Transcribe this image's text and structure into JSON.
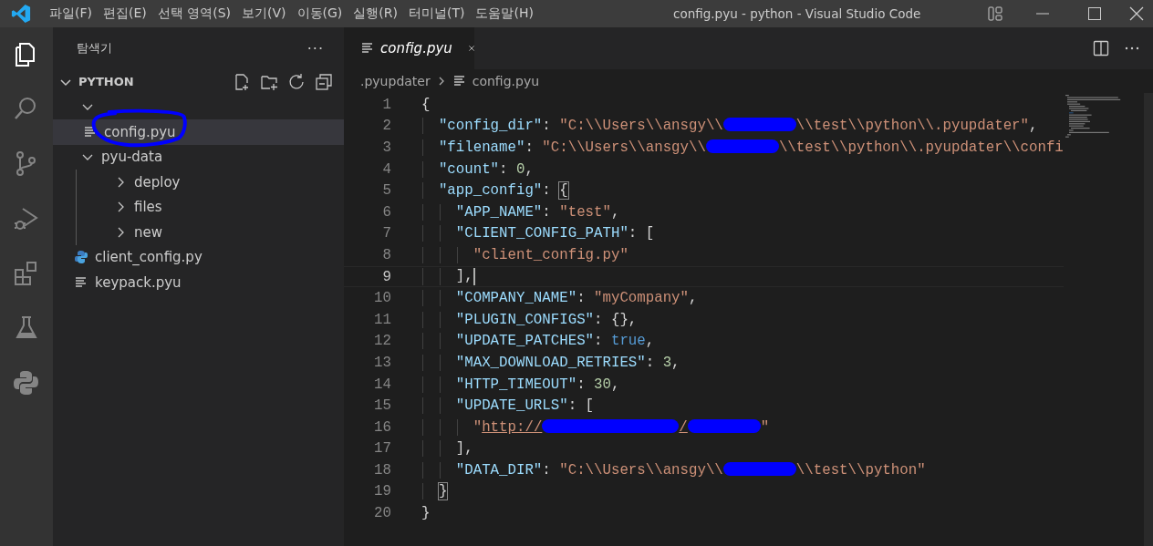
{
  "window": {
    "title": "config.pyu - python - Visual Studio Code"
  },
  "menu": [
    "파일(F)",
    "편집(E)",
    "선택 영역(S)",
    "보기(V)",
    "이동(G)",
    "실행(R)",
    "터미널(T)",
    "도움말(H)"
  ],
  "activity_bar": [
    {
      "kind": "explorer",
      "selected": true
    },
    {
      "kind": "search",
      "selected": false
    },
    {
      "kind": "source-control",
      "selected": false
    },
    {
      "kind": "run-debug",
      "selected": false
    },
    {
      "kind": "extensions",
      "selected": false
    },
    {
      "kind": "testing",
      "selected": false
    },
    {
      "kind": "python",
      "selected": false
    }
  ],
  "sidebar": {
    "title": "탐색기",
    "more": "···",
    "section": {
      "label": "PYTHON",
      "expanded": true,
      "tree": [
        {
          "kind": "folder",
          "expanded": true,
          "selected": false,
          "children": [
            {
              "kind": "file",
              "label": "config.pyu",
              "selected": true
            }
          ]
        },
        {
          "kind": "folder",
          "label": "pyu-data",
          "expanded": true,
          "selected": false,
          "children": [
            {
              "kind": "folder",
              "label": "deploy",
              "expanded": false,
              "selected": false
            },
            {
              "kind": "folder",
              "label": "files",
              "expanded": false,
              "selected": false
            },
            {
              "kind": "folder",
              "label": "new",
              "expanded": false,
              "selected": false
            }
          ]
        },
        {
          "kind": "python",
          "label": "client_config.py",
          "selected": false
        },
        {
          "kind": "file",
          "label": "keypack.pyu",
          "selected": false
        }
      ]
    }
  },
  "tabs": [
    {
      "label": "config.pyu",
      "selected": true,
      "preview": true
    }
  ],
  "breadcrumb": [
    ".pyupdater",
    "config.pyu"
  ],
  "editor": {
    "lines": [
      {
        "number": "1",
        "current": false,
        "tokens": [
          {
            "kind": "punct",
            "text": "{"
          }
        ]
      },
      {
        "number": "2",
        "current": false,
        "tokens": [
          {
            "kind": "key",
            "text": "  \"config_dir\""
          },
          {
            "kind": "punct",
            "text": ": "
          },
          {
            "kind": "str",
            "text": "\"C:\\\\Users\\\\ansgy\\\\"
          },
          {
            "kind": "redacted"
          },
          {
            "kind": "str",
            "text": "\\\\test\\\\python\\\\.pyupdater\""
          },
          {
            "kind": "punct",
            "text": ","
          }
        ]
      },
      {
        "number": "3",
        "current": false,
        "tokens": [
          {
            "kind": "key",
            "text": "  \"filename\""
          },
          {
            "kind": "punct",
            "text": ": "
          },
          {
            "kind": "str",
            "text": "\"C:\\\\Users\\\\ansgy\\\\"
          },
          {
            "kind": "redacted"
          },
          {
            "kind": "str",
            "text": "\\\\test\\\\python\\\\.pyupdater\\\\confi"
          }
        ]
      },
      {
        "number": "4",
        "current": false,
        "tokens": [
          {
            "kind": "key",
            "text": "  \"count\""
          },
          {
            "kind": "punct",
            "text": ": "
          },
          {
            "kind": "num",
            "text": "0"
          },
          {
            "kind": "punct",
            "text": ","
          }
        ]
      },
      {
        "number": "5",
        "current": false,
        "tokens": [
          {
            "kind": "key",
            "text": "  \"app_config\""
          },
          {
            "kind": "punct",
            "text": ": "
          },
          {
            "kind": "bracket-match",
            "text": "{"
          }
        ]
      },
      {
        "number": "6",
        "current": false,
        "tokens": [
          {
            "kind": "key",
            "text": "    \"APP_NAME\""
          },
          {
            "kind": "punct",
            "text": ": "
          },
          {
            "kind": "str",
            "text": "\"test\""
          },
          {
            "kind": "punct",
            "text": ","
          }
        ]
      },
      {
        "number": "7",
        "current": false,
        "tokens": [
          {
            "kind": "key",
            "text": "    \"CLIENT_CONFIG_PATH\""
          },
          {
            "kind": "punct",
            "text": ": ["
          }
        ]
      },
      {
        "number": "8",
        "current": false,
        "tokens": [
          {
            "kind": "str",
            "text": "      \"client_config.py\""
          }
        ]
      },
      {
        "number": "9",
        "current": true,
        "tokens": [
          {
            "kind": "punct",
            "text": "    ],"
          }
        ]
      },
      {
        "number": "10",
        "current": false,
        "tokens": [
          {
            "kind": "key",
            "text": "    \"COMPANY_NAME\""
          },
          {
            "kind": "punct",
            "text": ": "
          },
          {
            "kind": "str",
            "text": "\"myCompany\""
          },
          {
            "kind": "punct",
            "text": ","
          }
        ]
      },
      {
        "number": "11",
        "current": false,
        "tokens": [
          {
            "kind": "key",
            "text": "    \"PLUGIN_CONFIGS\""
          },
          {
            "kind": "punct",
            "text": ": {},"
          }
        ]
      },
      {
        "number": "12",
        "current": false,
        "tokens": [
          {
            "kind": "key",
            "text": "    \"UPDATE_PATCHES\""
          },
          {
            "kind": "punct",
            "text": ": "
          },
          {
            "kind": "bool",
            "text": "true"
          },
          {
            "kind": "punct",
            "text": ","
          }
        ]
      },
      {
        "number": "13",
        "current": false,
        "tokens": [
          {
            "kind": "key",
            "text": "    \"MAX_DOWNLOAD_RETRIES\""
          },
          {
            "kind": "punct",
            "text": ": "
          },
          {
            "kind": "num",
            "text": "3"
          },
          {
            "kind": "punct",
            "text": ","
          }
        ]
      },
      {
        "number": "14",
        "current": false,
        "tokens": [
          {
            "kind": "key",
            "text": "    \"HTTP_TIMEOUT\""
          },
          {
            "kind": "punct",
            "text": ": "
          },
          {
            "kind": "num",
            "text": "30"
          },
          {
            "kind": "punct",
            "text": ","
          }
        ]
      },
      {
        "number": "15",
        "current": false,
        "tokens": [
          {
            "kind": "key",
            "text": "    \"UPDATE_URLS\""
          },
          {
            "kind": "punct",
            "text": ": ["
          }
        ]
      },
      {
        "number": "16",
        "current": false,
        "tokens": [
          {
            "kind": "str",
            "text": "      \""
          },
          {
            "kind": "link",
            "text": "http://"
          },
          {
            "kind": "redacted-long"
          },
          {
            "kind": "link",
            "text": "/"
          },
          {
            "kind": "redacted"
          },
          {
            "kind": "str",
            "text": "\""
          }
        ]
      },
      {
        "number": "17",
        "current": false,
        "tokens": [
          {
            "kind": "punct",
            "text": "    ],"
          }
        ]
      },
      {
        "number": "18",
        "current": false,
        "tokens": [
          {
            "kind": "key",
            "text": "    \"DATA_DIR\""
          },
          {
            "kind": "punct",
            "text": ": "
          },
          {
            "kind": "str",
            "text": "\"C:\\\\Users\\\\ansgy\\\\"
          },
          {
            "kind": "redacted"
          },
          {
            "kind": "str",
            "text": "\\\\test\\\\python\""
          }
        ]
      },
      {
        "number": "19",
        "current": false,
        "tokens": [
          {
            "kind": "bracket-match",
            "text": "  }"
          }
        ]
      },
      {
        "number": "20",
        "current": false,
        "tokens": [
          {
            "kind": "punct",
            "text": "}"
          }
        ]
      }
    ]
  }
}
